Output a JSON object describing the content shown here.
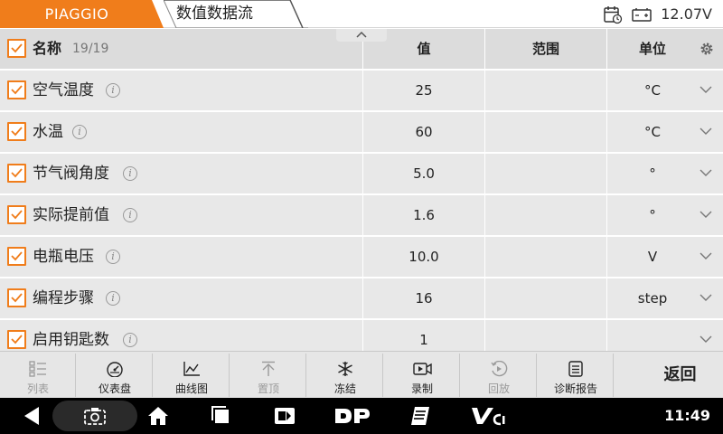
{
  "header": {
    "brand": "PIAGGIO",
    "title": "数值数据流",
    "voltage": "12.07V",
    "brand_color": "#f07d1b"
  },
  "table": {
    "columns": {
      "name": "名称",
      "count": "19/19",
      "value": "值",
      "range": "范围",
      "unit": "单位"
    },
    "rows": [
      {
        "name": "空气温度",
        "value": "25",
        "range": "",
        "unit": "°C"
      },
      {
        "name": "水温",
        "value": "60",
        "range": "",
        "unit": "°C"
      },
      {
        "name": "节气阀角度",
        "value": "5.0",
        "range": "",
        "unit": "°"
      },
      {
        "name": "实际提前值",
        "value": "1.6",
        "range": "",
        "unit": "°"
      },
      {
        "name": "电瓶电压",
        "value": "10.0",
        "range": "",
        "unit": "V"
      },
      {
        "name": "编程步骤",
        "value": "16",
        "range": "",
        "unit": "step"
      },
      {
        "name": "启用钥匙数",
        "value": "1",
        "range": "",
        "unit": ""
      }
    ]
  },
  "toolbar": {
    "list": "列表",
    "dashboard": "仪表盘",
    "graph": "曲线图",
    "top": "置顶",
    "freeze": "冻结",
    "record": "录制",
    "playback": "回放",
    "report": "诊断报告",
    "back": "返回"
  },
  "statusbar": {
    "time": "11:49"
  }
}
